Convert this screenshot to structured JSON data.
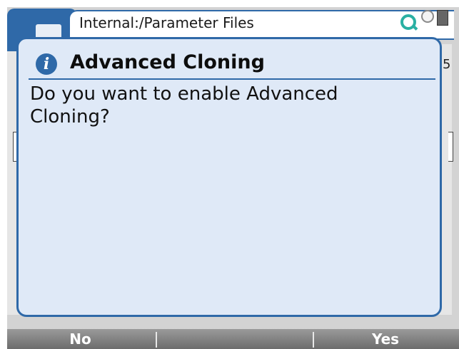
{
  "header": {
    "path": "Internal:/Parameter Files",
    "icons": [
      "folder-icon",
      "search-icon",
      "user-icon",
      "device-icon"
    ]
  },
  "background_list": {
    "visible_fragment": "5"
  },
  "dialog": {
    "icon": "info-icon",
    "icon_glyph": "i",
    "title": "Advanced Cloning",
    "message": "Do you want to enable Advanced Cloning?"
  },
  "softkeys": {
    "left": "No",
    "middle": "",
    "right": "Yes"
  },
  "colors": {
    "accent": "#2f69a8",
    "dialog_bg": "#dfe9f7",
    "search_icon": "#2ab0a3",
    "softkey_bar": "#808080"
  }
}
